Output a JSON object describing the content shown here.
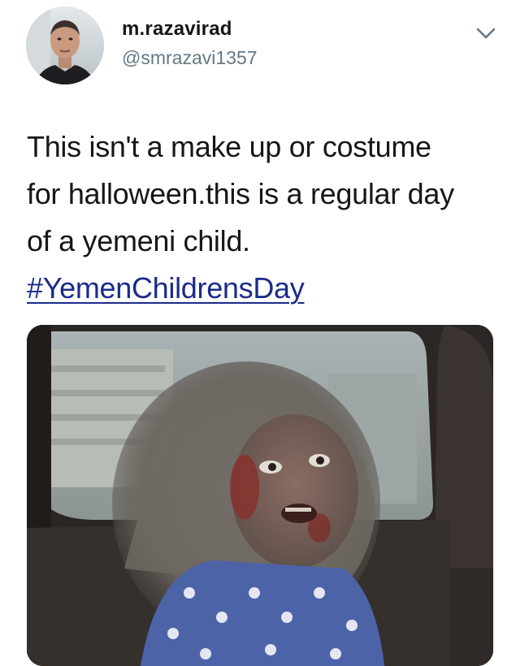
{
  "user": {
    "display_name": "m.razavirad",
    "handle": "@smrazavi1357",
    "avatar_icon": "profile-photo"
  },
  "menu": {
    "icon": "chevron-down-icon",
    "color": "#657786"
  },
  "tweet": {
    "lines": [
      "This isn't a make up or costume",
      "for halloween.this is a regular day",
      "of a yemeni child."
    ],
    "hashtag": "#YemenChildrensDay",
    "hashtag_color": "#1b2b8a"
  },
  "media": {
    "kind": "photo"
  }
}
